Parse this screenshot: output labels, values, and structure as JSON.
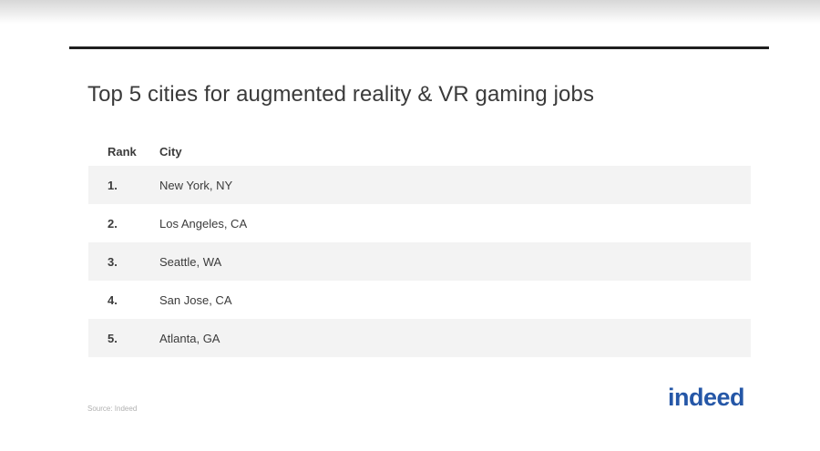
{
  "title": "Top 5 cities for augmented reality & VR gaming jobs",
  "chart_data": {
    "type": "table",
    "title": "Top 5 cities for augmented reality & VR gaming jobs",
    "columns": [
      "Rank",
      "City"
    ],
    "rows": [
      [
        "1.",
        "New York, NY"
      ],
      [
        "2.",
        "Los Angeles, CA"
      ],
      [
        "3.",
        "Seattle, WA"
      ],
      [
        "4.",
        "San Jose, CA"
      ],
      [
        "5.",
        "Atlanta, GA"
      ]
    ]
  },
  "source": "Source: Indeed",
  "logo": {
    "text": "indeed",
    "color": "#2557a7"
  },
  "colors": {
    "stripe": "#f3f3f3",
    "rule": "#1f1f1f",
    "text": "#3b3b3b"
  }
}
